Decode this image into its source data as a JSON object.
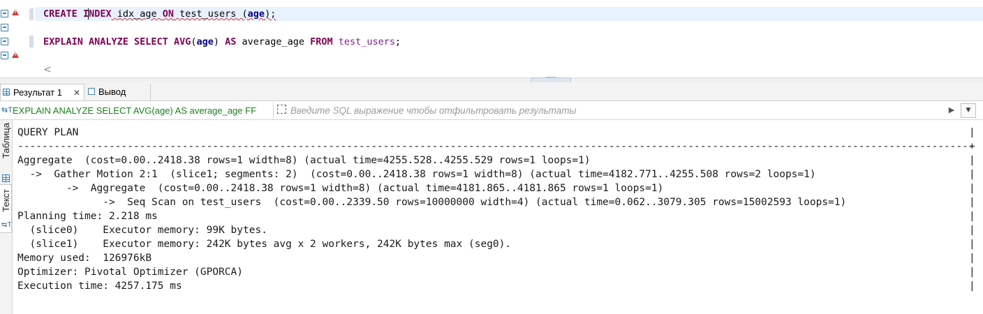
{
  "editor": {
    "line1": {
      "kw1": "CREATE",
      "kw2_pre": "I",
      "kw2_post": "NDEX",
      "sp1": " idx_age ",
      "kw3": "ON",
      "sp2": " test_users (",
      "col": "age",
      "end": ");"
    },
    "line2": {
      "kw1": "EXPLAIN ANALYZE SELECT",
      "sp0": " ",
      "fn": "AVG",
      "p1": "(",
      "col": "age",
      "p2": ")",
      "sp1": " ",
      "kw2": "AS",
      "sp2": " average_age ",
      "kw3": "FROM",
      "sp3": " ",
      "tbl": "test_users",
      "end": ";"
    },
    "scroll_left_glyph": "<"
  },
  "results": {
    "tabs": [
      {
        "label": "Результат 1",
        "close": "✕"
      },
      {
        "label": "Вывод"
      }
    ],
    "query_label": "EXPLAIN ANALYZE SELECT AVG(age) AS average_age FF",
    "query_label_icon": "⇆T",
    "filter_placeholder": "Введите SQL выражение чтобы отфильтровать результаты",
    "run_filter_glyph": "▶",
    "filter_history_glyph": "▼",
    "side_tabs": {
      "table": "Таблица",
      "text": "Текст",
      "text_icon": "⇆T"
    },
    "output_lines": [
      "QUERY PLAN",
      "------------------------------------------------------------------------------------------------------------------------------------------------------------------------------",
      "Aggregate  (cost=0.00..2418.38 rows=1 width=8) (actual time=4255.528..4255.529 rows=1 loops=1)",
      "  ->  Gather Motion 2:1  (slice1; segments: 2)  (cost=0.00..2418.38 rows=1 width=8) (actual time=4182.771..4255.508 rows=2 loops=1)",
      "        ->  Aggregate  (cost=0.00..2418.38 rows=1 width=8) (actual time=4181.865..4181.865 rows=1 loops=1)",
      "              ->  Seq Scan on test_users  (cost=0.00..2339.50 rows=10000000 width=4) (actual time=0.062..3079.305 rows=15002593 loops=1)",
      "Planning time: 2.218 ms",
      "  (slice0)    Executor memory: 99K bytes.",
      "  (slice1)    Executor memory: 242K bytes avg x 2 workers, 242K bytes max (seg0).",
      "Memory used:  126976kB",
      "Optimizer: Pivotal Optimizer (GPORCA)",
      "Execution time: 4257.175 ms"
    ],
    "right_border": "|",
    "separator_end": "+"
  }
}
